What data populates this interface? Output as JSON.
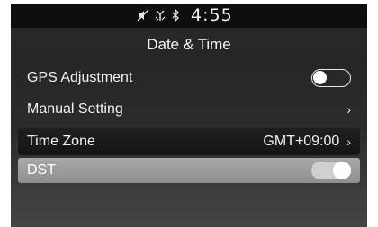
{
  "status_bar": {
    "icons": [
      "mute-icon",
      "antenna-icon",
      "bluetooth-icon"
    ],
    "time": "4:55"
  },
  "screen": {
    "title": "Date & Time"
  },
  "settings": {
    "gps_adjustment": {
      "label": "GPS Adjustment",
      "enabled": false
    },
    "manual_setting": {
      "label": "Manual Setting",
      "chevron": "›"
    },
    "time_zone": {
      "label": "Time Zone",
      "value": "GMT+09:00",
      "chevron": "›"
    },
    "dst": {
      "label": "DST",
      "enabled": true
    }
  },
  "colors": {
    "status_bar_bg": "#0e0e0e",
    "screen_bg": "#2a2a2a",
    "selected_row_bg": "#9a9a9a"
  }
}
